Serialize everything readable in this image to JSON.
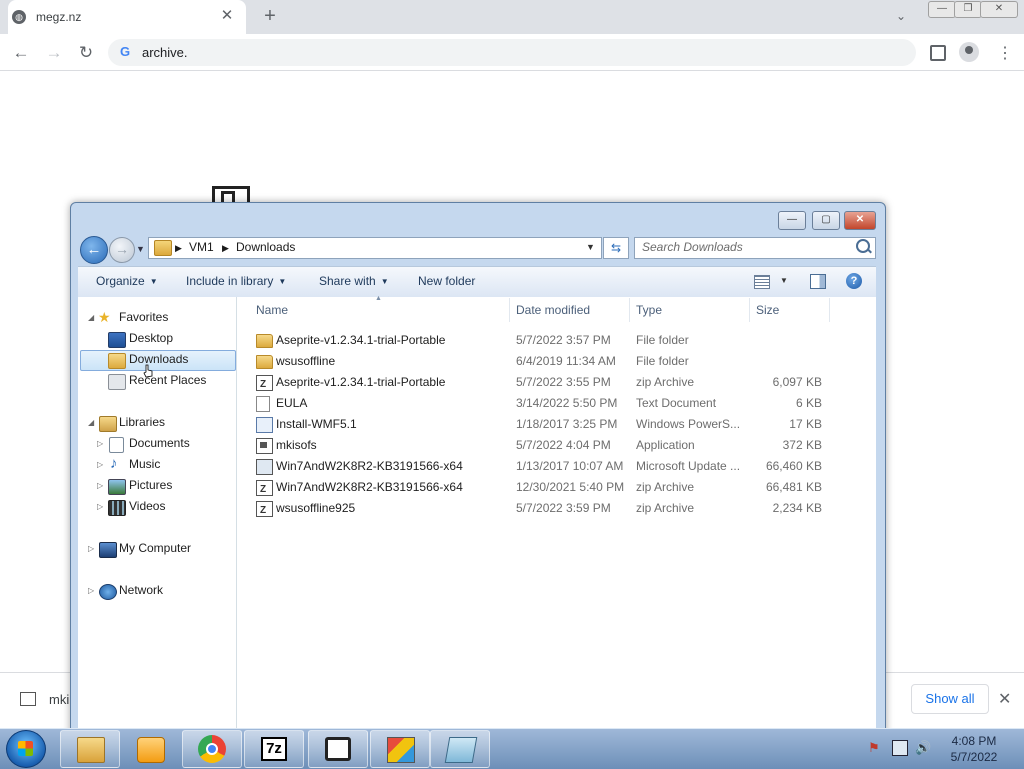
{
  "browser": {
    "tab_title": "megz.nz",
    "tab_close": "✕",
    "new_tab": "+",
    "tab_search": "⌄",
    "window_buttons": [
      "—",
      "❐",
      "✕"
    ],
    "nav": {
      "back": "←",
      "forward": "→",
      "reload": "↻"
    },
    "address": "archive.",
    "google_icon": "G",
    "right_icons": [
      "side-panel-icon",
      "profile-icon",
      "menu-icon"
    ],
    "menu_glyph": "⋮"
  },
  "download_bar": {
    "item_name": "mki",
    "show_all": "Show all",
    "close": "✕"
  },
  "explorer": {
    "window_buttons": [
      "—",
      "▢",
      "✕"
    ],
    "back": "←",
    "forward": "→",
    "breadcrumb": [
      "VM1",
      "Downloads"
    ],
    "search_placeholder": "Search Downloads",
    "refresh": "⇆",
    "commands": [
      "Organize",
      "Include in library",
      "Share with",
      "New folder"
    ],
    "help": "?",
    "nav_pane": {
      "favorites": {
        "label": "Favorites",
        "items": [
          "Desktop",
          "Downloads",
          "Recent Places"
        ]
      },
      "libraries": {
        "label": "Libraries",
        "items": [
          "Documents",
          "Music",
          "Pictures",
          "Videos"
        ]
      },
      "computer": "My Computer",
      "network": "Network",
      "selected": "Downloads"
    },
    "columns": [
      "Name",
      "Date modified",
      "Type",
      "Size"
    ],
    "files": [
      {
        "name": "Aseprite-v1.2.34.1-trial-Portable",
        "date": "5/7/2022 3:57 PM",
        "type": "File folder",
        "size": "",
        "icon": "folder"
      },
      {
        "name": "wsusoffline",
        "date": "6/4/2019 11:34 AM",
        "type": "File folder",
        "size": "",
        "icon": "folder"
      },
      {
        "name": "Aseprite-v1.2.34.1-trial-Portable",
        "date": "5/7/2022 3:55 PM",
        "type": "zip Archive",
        "size": "6,097 KB",
        "icon": "zip"
      },
      {
        "name": "EULA",
        "date": "3/14/2022 5:50 PM",
        "type": "Text Document",
        "size": "6 KB",
        "icon": "doc"
      },
      {
        "name": "Install-WMF5.1",
        "date": "1/18/2017 3:25 PM",
        "type": "Windows PowerS...",
        "size": "17 KB",
        "icon": "ps"
      },
      {
        "name": "mkisofs",
        "date": "5/7/2022 4:04 PM",
        "type": "Application",
        "size": "372 KB",
        "icon": "app"
      },
      {
        "name": "Win7AndW2K8R2-KB3191566-x64",
        "date": "1/13/2017 10:07 AM",
        "type": "Microsoft Update ...",
        "size": "66,460 KB",
        "icon": "msu"
      },
      {
        "name": "Win7AndW2K8R2-KB3191566-x64",
        "date": "12/30/2021 5:40 PM",
        "type": "zip Archive",
        "size": "66,481 KB",
        "icon": "zip"
      },
      {
        "name": "wsusoffline925",
        "date": "5/7/2022 3:59 PM",
        "type": "zip Archive",
        "size": "2,234 KB",
        "icon": "zip"
      }
    ]
  },
  "taskbar": {
    "pinned": [
      "explorer-icon",
      "media-player-icon",
      "chrome-icon",
      "7zip-icon",
      "aseprite-icon",
      "installer-icon",
      "notepad-icon"
    ],
    "sevenzip_label": "7z",
    "time": "4:08 PM",
    "date": "5/7/2022"
  }
}
